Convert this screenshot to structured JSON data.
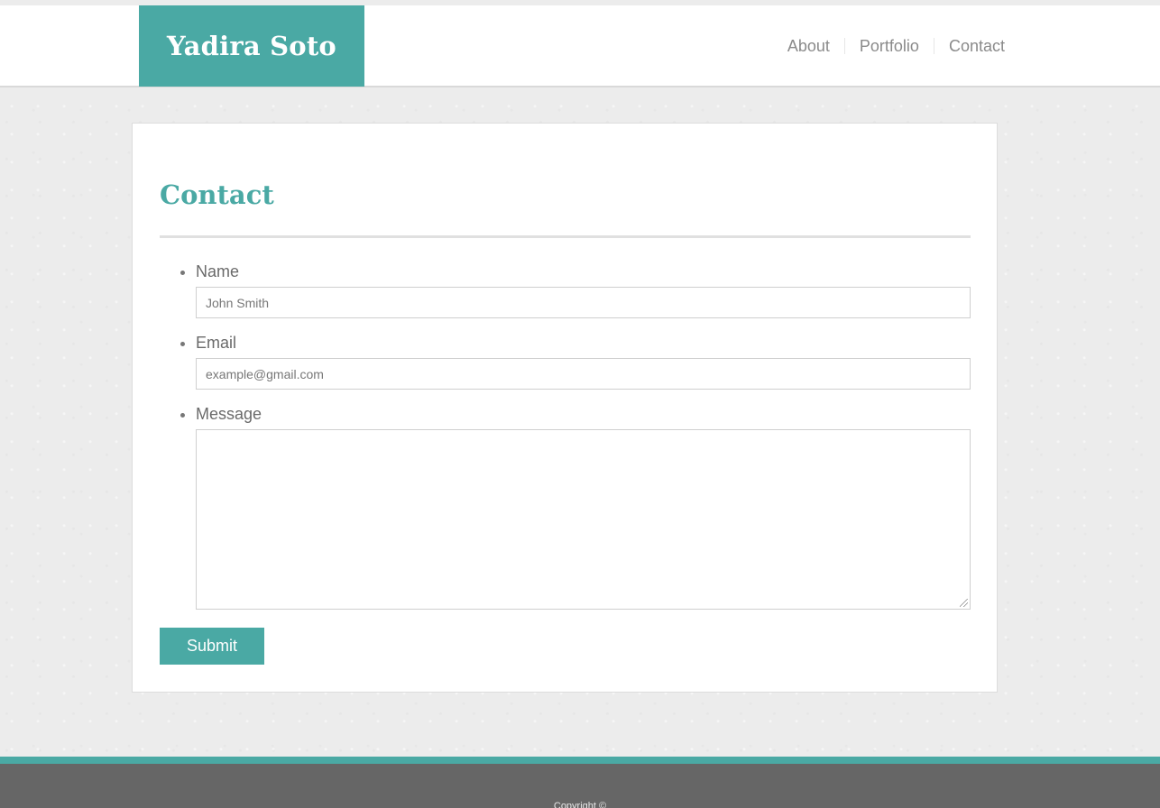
{
  "header": {
    "logo_text": "Yadira Soto",
    "nav": [
      {
        "label": "About"
      },
      {
        "label": "Portfolio"
      },
      {
        "label": "Contact"
      }
    ]
  },
  "contact": {
    "title": "Contact",
    "fields": {
      "name": {
        "label": "Name",
        "placeholder": "John Smith"
      },
      "email": {
        "label": "Email",
        "placeholder": "example@gmail.com"
      },
      "message": {
        "label": "Message",
        "value": ""
      }
    },
    "submit_label": "Submit"
  },
  "footer": {
    "copyright": "Copyright ©"
  },
  "colors": {
    "accent": "#4aa9a4",
    "footer": "#666666",
    "background": "#ececec"
  }
}
